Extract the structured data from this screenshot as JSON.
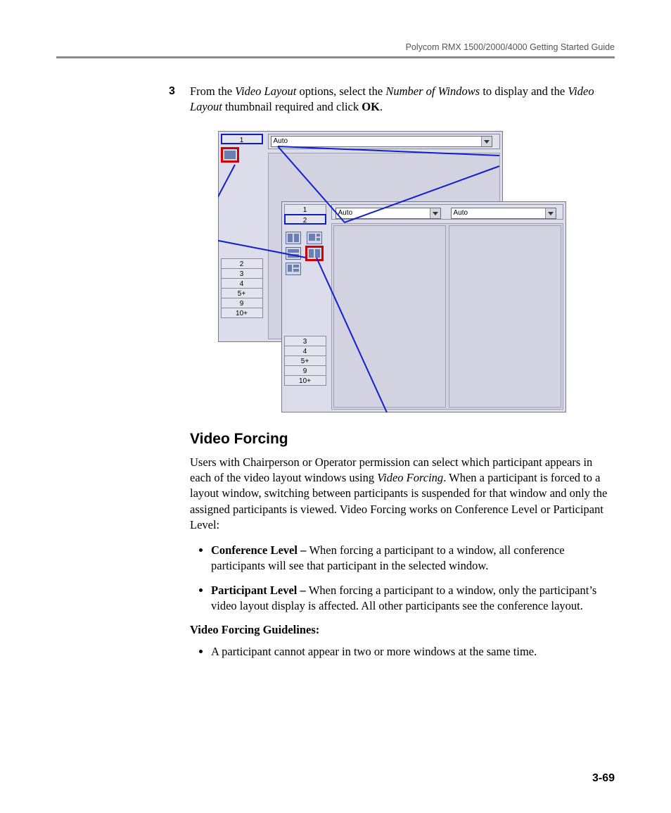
{
  "header": {
    "title": "Polycom RMX 1500/2000/4000 Getting Started Guide"
  },
  "step3": {
    "num": "3",
    "t1": "From the ",
    "i1": "Video Layout",
    "t2": " options, select the ",
    "i2": "Number of Windows",
    "t3": " to display and the ",
    "i3": "Video Layout",
    "t4": " thumbnail required and click ",
    "b1": "OK",
    "t5": "."
  },
  "figure": {
    "panel1": {
      "top": "1",
      "bottom": [
        "2",
        "3",
        "4",
        "5+",
        "9",
        "10+"
      ],
      "dropdown": "Auto"
    },
    "panel2": {
      "top": [
        "1",
        "2"
      ],
      "bottom": [
        "3",
        "4",
        "5+",
        "9",
        "10+"
      ],
      "dropdown1": "Auto",
      "dropdown2": "Auto"
    }
  },
  "section": {
    "title": "Video Forcing"
  },
  "body": {
    "p1a": "Users with Chairperson or Operator permission can select which participant appears in each of the video layout windows using ",
    "p1i": "Video Forcing",
    "p1b": ". When a participant is forced to a layout window, switching between participants is suspended for that window and only the assigned participants is viewed. Video Forcing works on Conference Level or Participant Level:",
    "li1b": "Conference Level – ",
    "li1t": "When forcing a participant to a window, all conference participants will see that participant in the selected window.",
    "li2b": "Participant Level – ",
    "li2t": "When forcing a participant to a window, only the participant’s video layout display is affected. All other participants see the conference layout.",
    "sub": "Video Forcing Guidelines:",
    "g1": "A participant cannot appear in two or more windows at the same time."
  },
  "pagenum": "3-69"
}
